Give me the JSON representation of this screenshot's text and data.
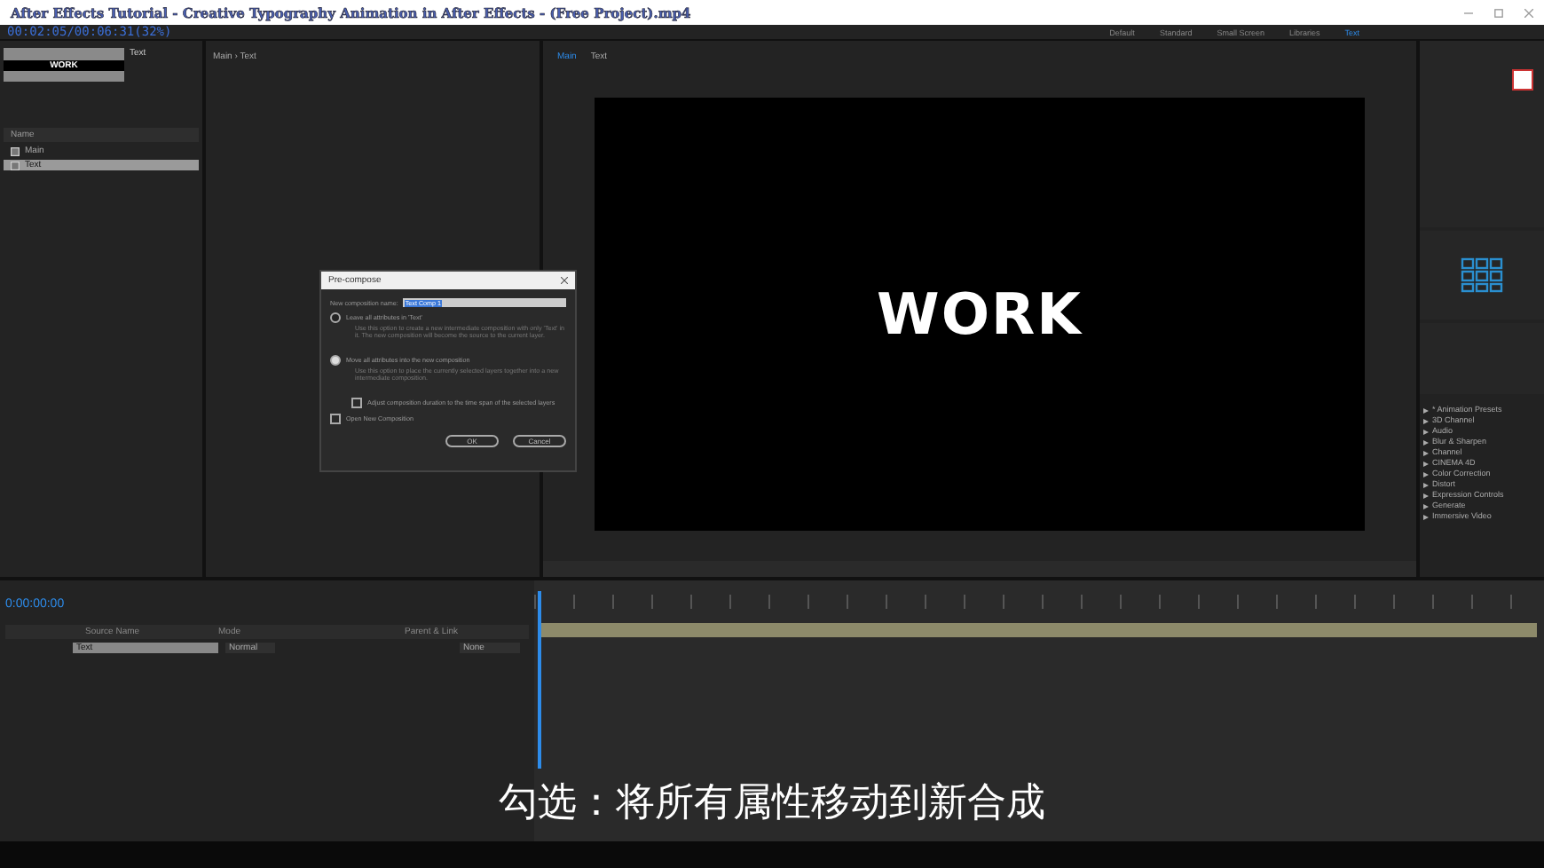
{
  "video_title": "After Effects Tutorial - Creative Typography Animation in After Effects - (Free Project).mp4",
  "playback_time": "00:02:05/00:06:31(32%)",
  "workspaces": [
    {
      "label": "Default",
      "selected": false
    },
    {
      "label": "Standard",
      "selected": false
    },
    {
      "label": "Small Screen",
      "selected": false
    },
    {
      "label": "Libraries",
      "selected": false
    },
    {
      "label": "Text",
      "selected": true
    }
  ],
  "project": {
    "thumbnail_text": "WORK",
    "info_name": "Text",
    "column": "Name",
    "items": [
      {
        "name": "Main",
        "selected": false
      },
      {
        "name": "Text",
        "selected": true
      }
    ]
  },
  "layer_panel": {
    "breadcrumb": "Main › Text"
  },
  "composition": {
    "tabs": [
      {
        "label": "Main",
        "selected": true
      },
      {
        "label": "Text",
        "selected": false
      }
    ],
    "canvas_text": "WORK"
  },
  "dialog": {
    "title": "Pre-compose",
    "name_label": "New composition name:",
    "name_value": "Text Comp 1",
    "options": [
      {
        "label": "Leave all attributes in 'Text'",
        "description": "Use this option to create a new intermediate composition with only 'Text' in it. The new composition will become the source to the current layer.",
        "selected": false
      },
      {
        "label": "Move all attributes into the new composition",
        "description": "Use this option to place the currently selected layers together into a new intermediate composition.",
        "selected": true
      }
    ],
    "adjust_duration": {
      "label": "Adjust composition duration to the time span of the selected layers",
      "checked": false
    },
    "open_new": {
      "label": "Open New Composition",
      "checked": false
    },
    "buttons": [
      "OK",
      "Cancel"
    ]
  },
  "effects": {
    "items": [
      "* Animation Presets",
      "3D Channel",
      "Audio",
      "Blur & Sharpen",
      "Channel",
      "CINEMA 4D",
      "Color Correction",
      "Distort",
      "Expression Controls",
      "Generate",
      "Immersive Video"
    ]
  },
  "timeline": {
    "timecode": "0:00:00:00",
    "columns": [
      "Source Name",
      "Mode",
      "Parent & Link"
    ],
    "layers": [
      {
        "name": "Text",
        "mode": "Normal",
        "parent": "None"
      }
    ]
  },
  "subtitle": "勾选：将所有属性移动到新合成"
}
